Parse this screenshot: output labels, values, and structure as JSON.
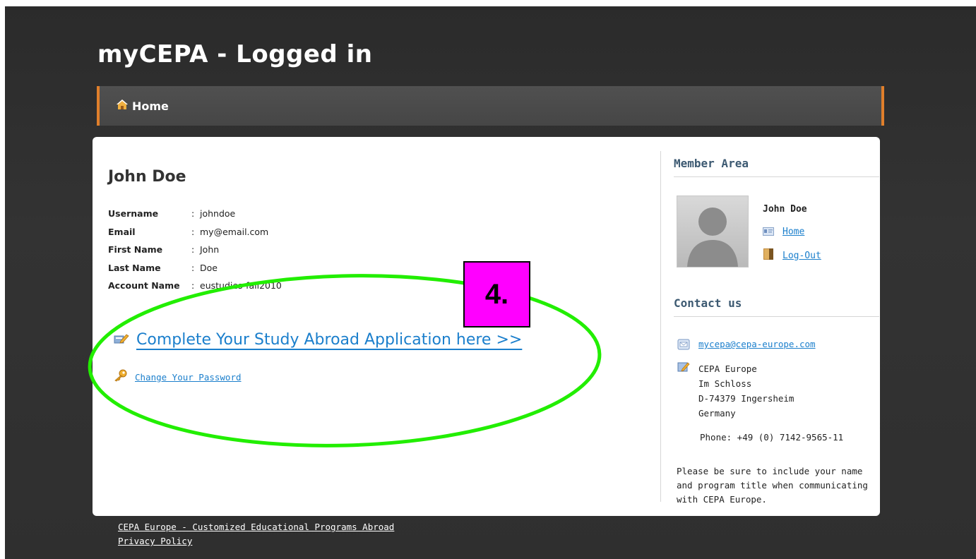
{
  "header": {
    "title": "myCEPA - Logged in"
  },
  "nav": {
    "home_label": "Home"
  },
  "profile": {
    "name": "John Doe",
    "fields": [
      {
        "label": "Username",
        "value": "johndoe"
      },
      {
        "label": "Email",
        "value": "my@email.com"
      },
      {
        "label": "First Name",
        "value": "John"
      },
      {
        "label": "Last Name",
        "value": "Doe"
      },
      {
        "label": "Account Name",
        "value": "eustudies-fall2010"
      }
    ],
    "separator": ":"
  },
  "actions": {
    "application_link": "Complete Your Study Abroad Application here >>",
    "password_link": "Change Your Password"
  },
  "sidebar": {
    "member_heading": "Member Area",
    "member_name": "John Doe",
    "home_link": "Home",
    "logout_link": "Log-Out",
    "contact_heading": "Contact us",
    "contact_email": "mycepa@cepa-europe.com",
    "address_lines": [
      "CEPA Europe",
      "Im Schloss",
      "D-74379 Ingersheim",
      "Germany"
    ],
    "phone": "Phone: +49 (0) 7142-9565-11",
    "note_lines": [
      "Please be sure to include your name",
      "and program title when communicating",
      "with CEPA Europe."
    ]
  },
  "footer": {
    "links": [
      "CEPA Europe - Customized Educational Programs Abroad",
      "Privacy Policy"
    ]
  },
  "annotation": {
    "badge_label": "4.",
    "ellipse_color": "#22ee00",
    "badge_color": "#ff00ff"
  },
  "colors": {
    "accent_orange": "#e07f2b",
    "link_blue": "#1b7fcc",
    "heading_blue": "#3d5a72"
  }
}
